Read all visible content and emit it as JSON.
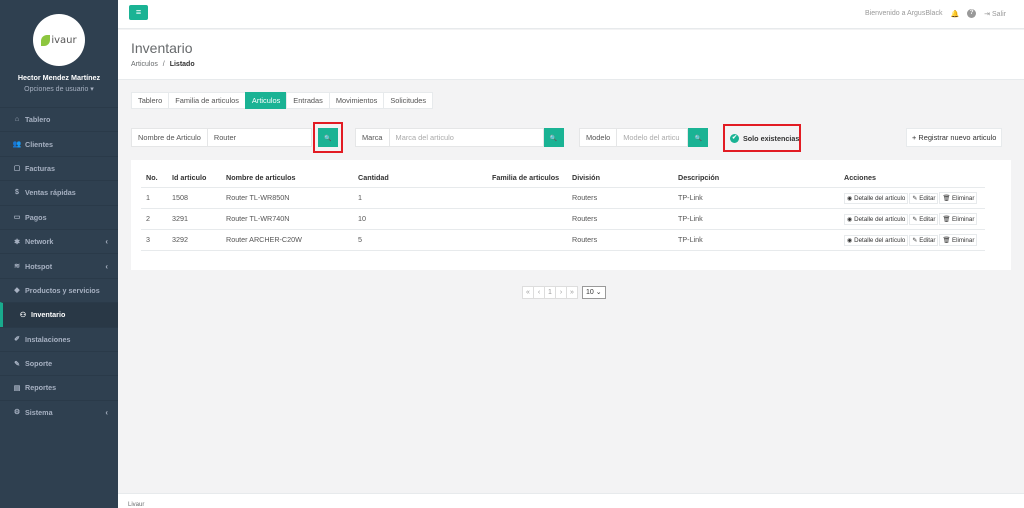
{
  "sidebar": {
    "logo_text": "ivaur",
    "user_name": "Hector Mendez Martínez",
    "user_options": "Opciones de usuario ▾",
    "items": [
      {
        "label": "Tablero",
        "icon": "⌂"
      },
      {
        "label": "Clientes",
        "icon": "👥"
      },
      {
        "label": "Facturas",
        "icon": "▢"
      },
      {
        "label": "Ventas rápidas",
        "icon": "$"
      },
      {
        "label": "Pagos",
        "icon": "▭"
      },
      {
        "label": "Network",
        "icon": "✱"
      },
      {
        "label": "Hotspot",
        "icon": "≋"
      },
      {
        "label": "Productos y servicios",
        "icon": "◆"
      },
      {
        "label": "Inventario",
        "icon": "⚇"
      },
      {
        "label": "Instalaciones",
        "icon": "✐"
      },
      {
        "label": "Soporte",
        "icon": "✎"
      },
      {
        "label": "Reportes",
        "icon": "▤"
      },
      {
        "label": "Sistema",
        "icon": "⚙"
      }
    ],
    "chevron": "‹"
  },
  "topbar": {
    "menu_icon": "≡",
    "welcome": "Bienvenido a ArgusBlack",
    "bell": "🔔",
    "help": "?",
    "logout_icon": "⇥",
    "logout": "Salir"
  },
  "heading": {
    "title": "Inventario",
    "crumb1": "Articulos",
    "sep": "/",
    "crumb2": "Listado"
  },
  "tabs": [
    "Tablero",
    "Familia de articulos",
    "Articulos",
    "Entradas",
    "Movimientos",
    "Solicitudes"
  ],
  "filters": {
    "name_label": "Nombre de Articulo",
    "name_value": "Router",
    "brand_label": "Marca",
    "brand_placeholder": "Marca del articulo",
    "model_label": "Modelo",
    "model_placeholder": "Modelo del articu",
    "search_icon": "🔍",
    "solo_icon": "✔",
    "solo_label": "Solo existencias",
    "register_label": "+ Registrar nuevo articulo"
  },
  "table": {
    "headers": [
      "No.",
      "Id articulo",
      "Nombre de articulos",
      "Cantidad",
      "Familia de articulos",
      "División",
      "Descripción",
      "Acciones"
    ],
    "rows": [
      {
        "no": "1",
        "id": "1508",
        "name": "Router TL-WR850N",
        "qty": "1",
        "family": "",
        "division": "Routers",
        "desc": "TP-Link"
      },
      {
        "no": "2",
        "id": "3291",
        "name": "Router TL-WR740N",
        "qty": "10",
        "family": "",
        "division": "Routers",
        "desc": "TP-Link"
      },
      {
        "no": "3",
        "id": "3292",
        "name": "Router ARCHER-C20W",
        "qty": "5",
        "family": "",
        "division": "Routers",
        "desc": "TP-Link"
      }
    ],
    "actions": {
      "detail": "◉ Detalle del artículo",
      "edit": "✎ Editar",
      "delete": "🗑 Eliminar"
    }
  },
  "pager": {
    "first": "«",
    "prev": "‹",
    "page": "1",
    "next": "›",
    "last": "»",
    "per_page": "10 ⌄"
  },
  "footer": {
    "text": "Livaur"
  },
  "colors": {
    "accent": "#1ab394",
    "sidebar": "#2f4050",
    "highlight": "#e21b23"
  }
}
